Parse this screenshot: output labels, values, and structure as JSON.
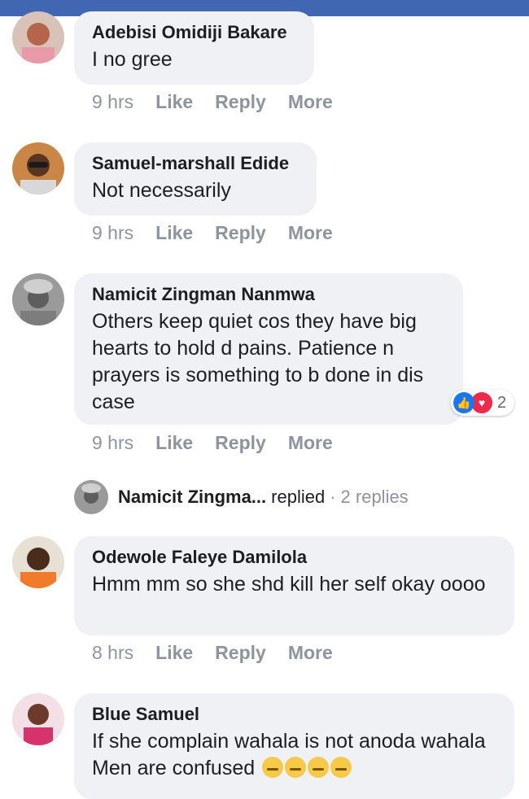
{
  "comments": [
    {
      "name": "Adebisi Omidiji Bakare",
      "text": "I no gree",
      "time": "9 hrs",
      "like": "Like",
      "reply": "Reply",
      "more": "More"
    },
    {
      "name": "Samuel-marshall Edide",
      "text": "Not necessarily",
      "time": "9 hrs",
      "like": "Like",
      "reply": "Reply",
      "more": "More"
    },
    {
      "name": "Namicit Zingman Nanmwa",
      "text": "Others keep quiet cos they have big hearts to hold d pains. Patience n prayers is something to b done in dis case",
      "time": "9 hrs",
      "like": "Like",
      "reply": "Reply",
      "more": "More",
      "reaction_count": "2"
    },
    {
      "name": "Odewole Faleye Damilola",
      "text": "Hmm mm so she shd kill her self okay oooo",
      "time": "8 hrs",
      "like": "Like",
      "reply": "Reply",
      "more": "More"
    },
    {
      "name": "Blue Samuel",
      "text": "If she complain wahala is not anoda wahala Men are confused"
    }
  ],
  "replies_link": {
    "name": "Namicit Zingma...",
    "word": "replied",
    "separator": "·",
    "count": "2 replies"
  },
  "colors": {
    "header": "#4267b2",
    "bubble": "#f0f1f4",
    "meta": "#8d949e",
    "like": "#1877f2",
    "love": "#f0284a"
  },
  "icons": [
    "like-reaction-icon",
    "love-reaction-icon",
    "expressionless-emoji-icon",
    "smirk-emoji-icon"
  ]
}
